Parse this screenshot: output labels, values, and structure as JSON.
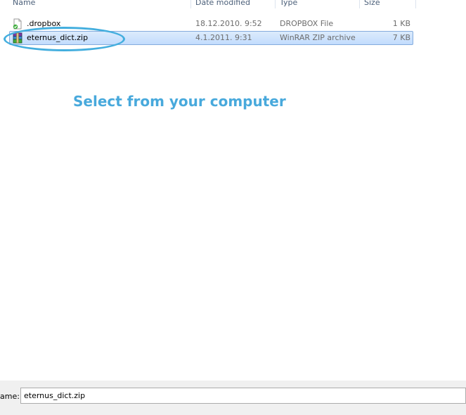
{
  "columns": {
    "name": "Name",
    "date_modified": "Date modified",
    "type": "Type",
    "size": "Size"
  },
  "files": [
    {
      "name": ".dropbox",
      "date": "18.12.2010. 9:52",
      "type": "DROPBOX File",
      "size": "1 KB",
      "icon": "dropbox-file-icon",
      "selected": false
    },
    {
      "name": "eternus_dict.zip",
      "date": "4.1.2011. 9:31",
      "type": "WinRAR ZIP archive",
      "size": "7 KB",
      "icon": "winrar-zip-icon",
      "selected": true
    }
  ],
  "callout": "Select from your computer",
  "filename_field": {
    "label": "ame:",
    "value": "eternus_dict.zip"
  },
  "colors": {
    "selection_background": "#cce0fa",
    "selection_border": "#84acdd",
    "callout_text": "#48a9dc",
    "highlight_ellipse": "#43aede",
    "column_header_text": "#4c607a"
  }
}
